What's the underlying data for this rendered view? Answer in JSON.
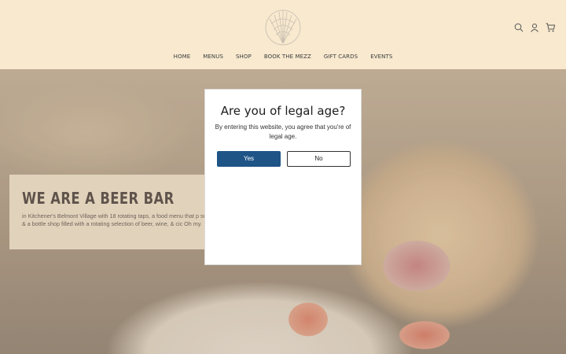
{
  "nav": {
    "items": [
      "HOME",
      "MENUS",
      "SHOP",
      "BOOK THE MEZZ",
      "GIFT CARDS",
      "EVENTS"
    ]
  },
  "icons": {
    "logo": "shell-logo",
    "search": "search-icon",
    "account": "user-icon",
    "cart": "cart-icon"
  },
  "hero": {
    "title": "WE ARE A BEER BAR",
    "text": "in Kitchener's Belmont Village with 18 rotating taps, a food menu that p suds, & a bottle shop filled with a rotating selection of beer, wine, & cic Oh my."
  },
  "modal": {
    "title": "Are you of legal age?",
    "text": "By entering this website, you agree that you're of legal age.",
    "yes_label": "Yes",
    "no_label": "No"
  },
  "colors": {
    "header_bg": "#f8e9cf",
    "primary_button": "#1f5487"
  }
}
